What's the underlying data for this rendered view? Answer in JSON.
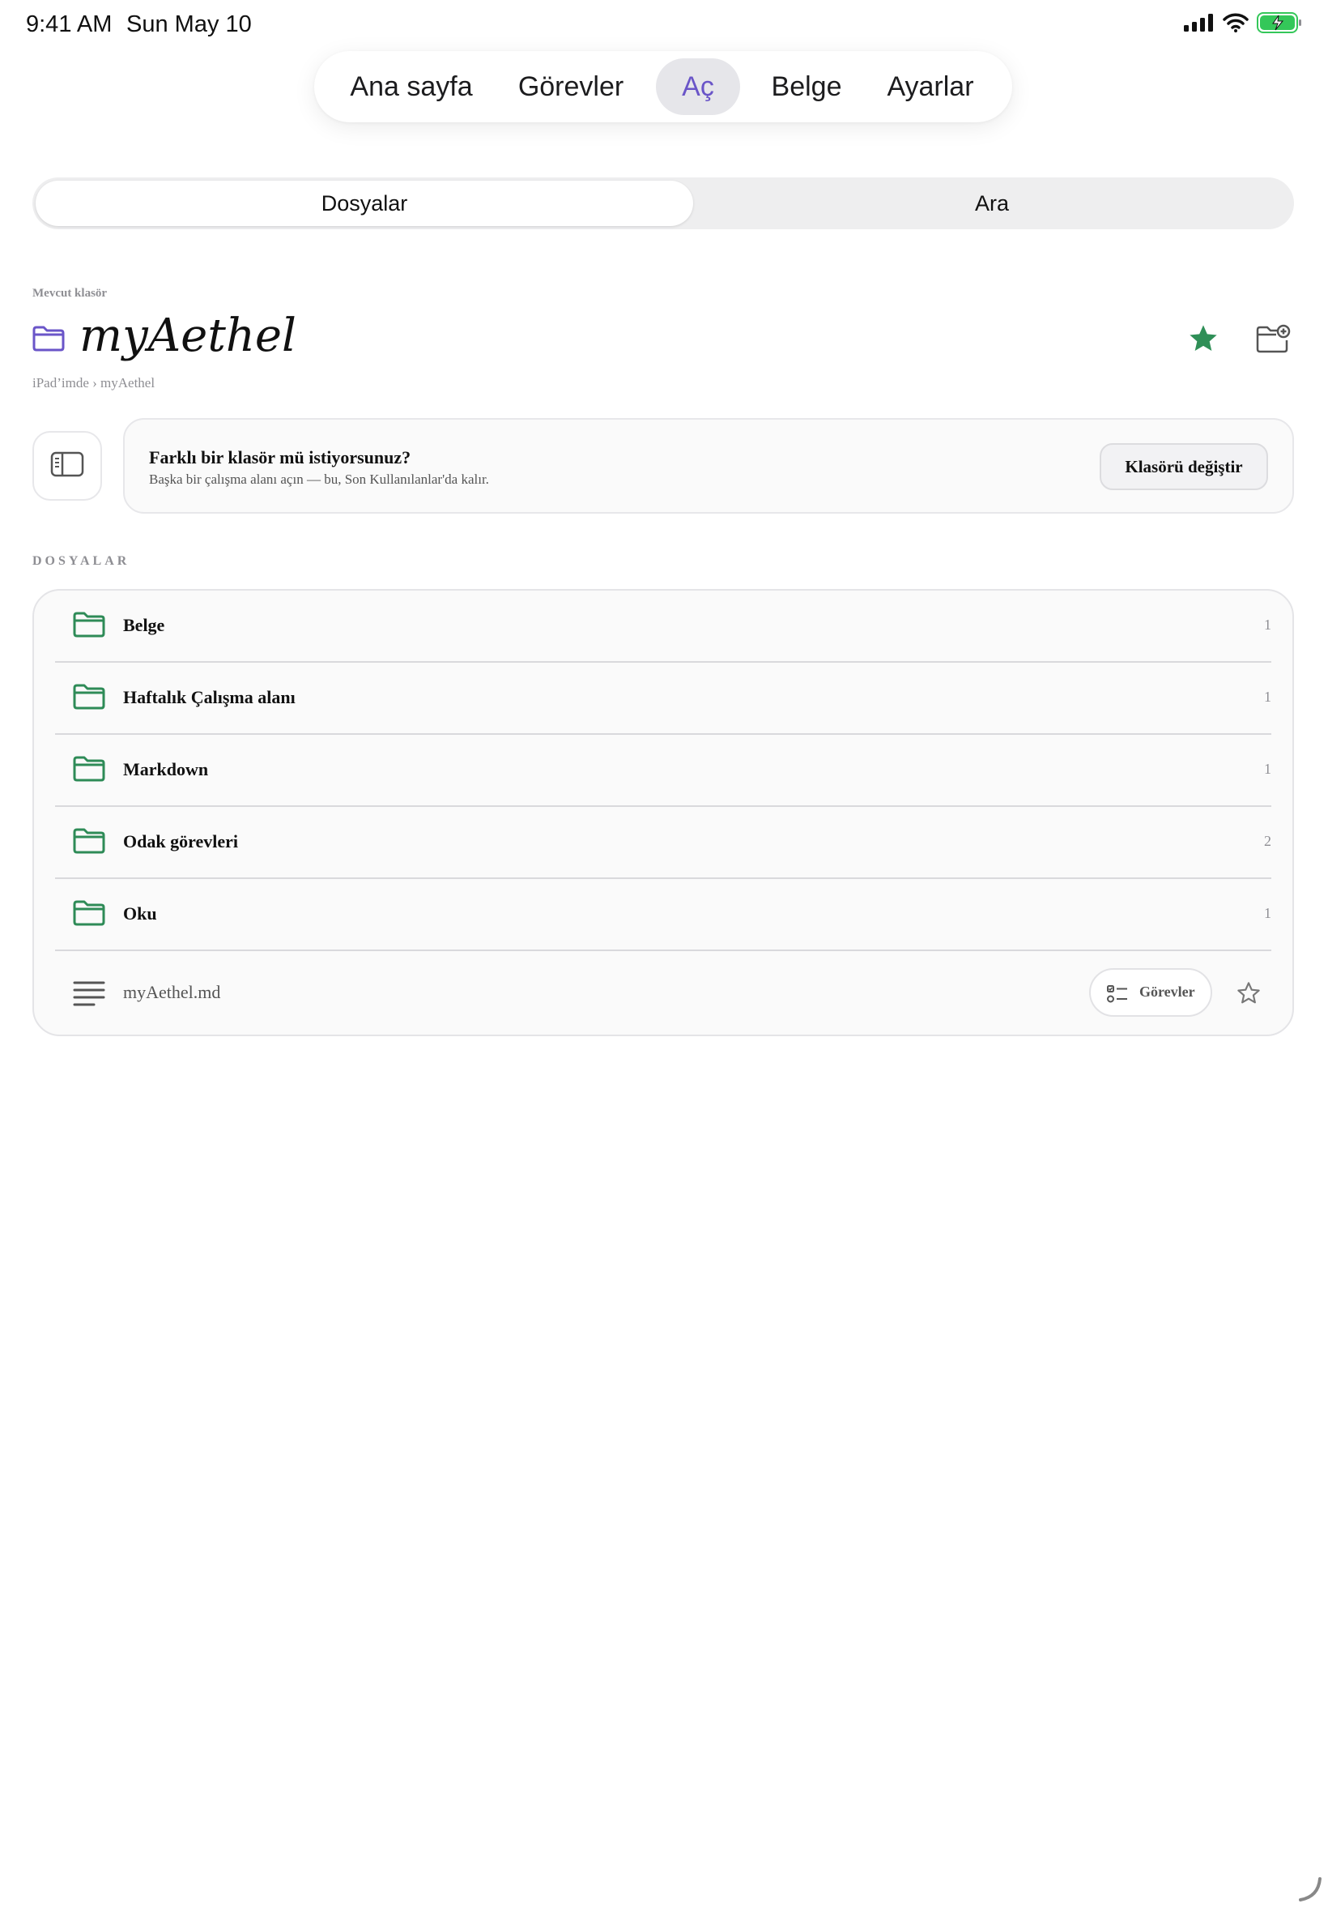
{
  "status_bar": {
    "time": "9:41 AM",
    "date": "Sun May 10"
  },
  "top_nav": {
    "tabs": [
      {
        "label": "Ana sayfa",
        "active": false
      },
      {
        "label": "Görevler",
        "active": false
      },
      {
        "label": "Aç",
        "active": true
      },
      {
        "label": "Belge",
        "active": false
      },
      {
        "label": "Ayarlar",
        "active": false
      }
    ]
  },
  "segmented": {
    "files_label": "Dosyalar",
    "search_label": "Ara",
    "selected": "Dosyalar"
  },
  "folder": {
    "current_label": "Mevcut klasör",
    "name": "myAethel",
    "breadcrumb": "iPad’imde › myAethel",
    "favorited": true
  },
  "banner": {
    "title": "Farklı bir klasör mü istiyorsunuz?",
    "subtitle": "Başka bir çalışma alanı açın — bu, Son Kullanılanlar'da kalır.",
    "button": "Klasörü değiştir"
  },
  "files_section": {
    "header": "DOSYALAR",
    "folders": [
      {
        "name": "Belge",
        "count": "1"
      },
      {
        "name": "Haftalık Çalışma alanı",
        "count": "1"
      },
      {
        "name": "Markdown",
        "count": "1"
      },
      {
        "name": "Odak görevleri",
        "count": "2"
      },
      {
        "name": "Oku",
        "count": "1"
      }
    ],
    "file": {
      "name": "myAethel.md",
      "tasks_label": "Görevler"
    }
  },
  "colors": {
    "accent": "#6a55c8",
    "folder_green": "#2e8b57",
    "star_green": "#2f8f57"
  },
  "icons": [
    "signal-icon",
    "wifi-icon",
    "battery-icon",
    "folder-icon",
    "star-icon",
    "folder-add-icon",
    "sidebar-icon",
    "document-icon",
    "tasks-icon",
    "star-outline-icon"
  ]
}
